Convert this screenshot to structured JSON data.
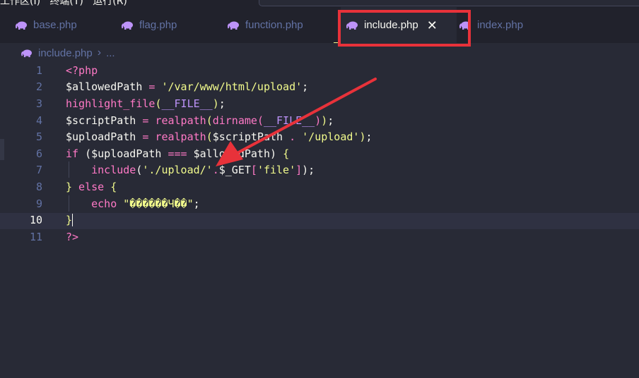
{
  "menubar": {
    "partial_text": "工作区(I)   终端(T)   运行(R)"
  },
  "tabs": [
    {
      "label": "base.php",
      "icon": "php-elephant-icon"
    },
    {
      "label": "flag.php",
      "icon": "php-elephant-icon"
    },
    {
      "label": "function.php",
      "icon": "php-elephant-icon"
    },
    {
      "label": "include.php",
      "icon": "php-elephant-icon",
      "active": true,
      "close_glyph": "✕"
    },
    {
      "label": "index.php",
      "icon": "php-elephant-icon"
    }
  ],
  "breadcrumb": {
    "file": "include.php",
    "separator": "›",
    "more": "..."
  },
  "editor": {
    "current_line": 10,
    "lines": [
      {
        "n": "1",
        "tokens": [
          {
            "t": "<?php",
            "c": "#ff79c6"
          }
        ]
      },
      {
        "n": "2",
        "tokens": [
          {
            "t": "$allowedPath",
            "c": "#f8f8f2"
          },
          {
            "t": " = ",
            "c": "#ff79c6"
          },
          {
            "t": "'/var/www/html/upload'",
            "c": "#f1fa8c"
          },
          {
            "t": ";",
            "c": "#f8f8f2"
          }
        ]
      },
      {
        "n": "3",
        "tokens": [
          {
            "t": "highlight_file",
            "c": "#ff79c6"
          },
          {
            "t": "(",
            "c": "#f1fa8c"
          },
          {
            "t": "__FILE__",
            "c": "#bd93f9"
          },
          {
            "t": ")",
            "c": "#f1fa8c"
          },
          {
            "t": ";",
            "c": "#f8f8f2"
          }
        ]
      },
      {
        "n": "4",
        "tokens": [
          {
            "t": "$scriptPath",
            "c": "#f8f8f2"
          },
          {
            "t": " = ",
            "c": "#ff79c6"
          },
          {
            "t": "realpath",
            "c": "#ff79c6"
          },
          {
            "t": "(",
            "c": "#f1fa8c"
          },
          {
            "t": "dirname",
            "c": "#ff79c6"
          },
          {
            "t": "(",
            "c": "#ff79c6"
          },
          {
            "t": "__FILE__",
            "c": "#bd93f9"
          },
          {
            "t": ")",
            "c": "#ff79c6"
          },
          {
            "t": ")",
            "c": "#f1fa8c"
          },
          {
            "t": ";",
            "c": "#f8f8f2"
          }
        ]
      },
      {
        "n": "5",
        "tokens": [
          {
            "t": "$uploadPath",
            "c": "#f8f8f2"
          },
          {
            "t": " = ",
            "c": "#ff79c6"
          },
          {
            "t": "realpath",
            "c": "#ff79c6"
          },
          {
            "t": "(",
            "c": "#f1fa8c"
          },
          {
            "t": "$scriptPath",
            "c": "#f8f8f2"
          },
          {
            "t": " . ",
            "c": "#ff79c6"
          },
          {
            "t": "'/upload'",
            "c": "#f1fa8c"
          },
          {
            "t": ")",
            "c": "#f1fa8c"
          },
          {
            "t": ";",
            "c": "#f8f8f2"
          }
        ]
      },
      {
        "n": "6",
        "tokens": [
          {
            "t": "if ",
            "c": "#ff79c6"
          },
          {
            "t": "(",
            "c": "#f8f8f2"
          },
          {
            "t": "$uploadPath",
            "c": "#f8f8f2"
          },
          {
            "t": " === ",
            "c": "#ff79c6"
          },
          {
            "t": "$allowedPath",
            "c": "#f8f8f2"
          },
          {
            "t": ") ",
            "c": "#f8f8f2"
          },
          {
            "t": "{",
            "c": "#f1fa8c"
          }
        ]
      },
      {
        "n": "7",
        "indent": true,
        "tokens": [
          {
            "t": "    ",
            "c": "#f8f8f2"
          },
          {
            "t": "include",
            "c": "#ff79c6"
          },
          {
            "t": "(",
            "c": "#f8f8f2"
          },
          {
            "t": "'./upload/'",
            "c": "#f1fa8c"
          },
          {
            "t": ".",
            "c": "#ff79c6"
          },
          {
            "t": "$_GET",
            "c": "#f8f8f2"
          },
          {
            "t": "[",
            "c": "#ff79c6"
          },
          {
            "t": "'file'",
            "c": "#f1fa8c"
          },
          {
            "t": "]",
            "c": "#ff79c6"
          },
          {
            "t": ");",
            "c": "#f8f8f2"
          }
        ]
      },
      {
        "n": "8",
        "tokens": [
          {
            "t": "}",
            "c": "#f1fa8c"
          },
          {
            "t": " else ",
            "c": "#ff79c6"
          },
          {
            "t": "{",
            "c": "#f1fa8c"
          }
        ]
      },
      {
        "n": "9",
        "indent": true,
        "tokens": [
          {
            "t": "    ",
            "c": "#f8f8f2"
          },
          {
            "t": "echo ",
            "c": "#ff79c6"
          },
          {
            "t": "\"������Ч��\"",
            "c": "#f1fa8c"
          },
          {
            "t": ";",
            "c": "#f8f8f2"
          }
        ]
      },
      {
        "n": "10",
        "tokens": [
          {
            "t": "}",
            "c": "#f1fa8c"
          }
        ],
        "caret": true
      },
      {
        "n": "11",
        "tokens": [
          {
            "t": "?>",
            "c": "#ff79c6"
          }
        ]
      }
    ]
  },
  "annotation": {
    "box_color": "#e8323a",
    "arrow_color": "#e8323a"
  }
}
